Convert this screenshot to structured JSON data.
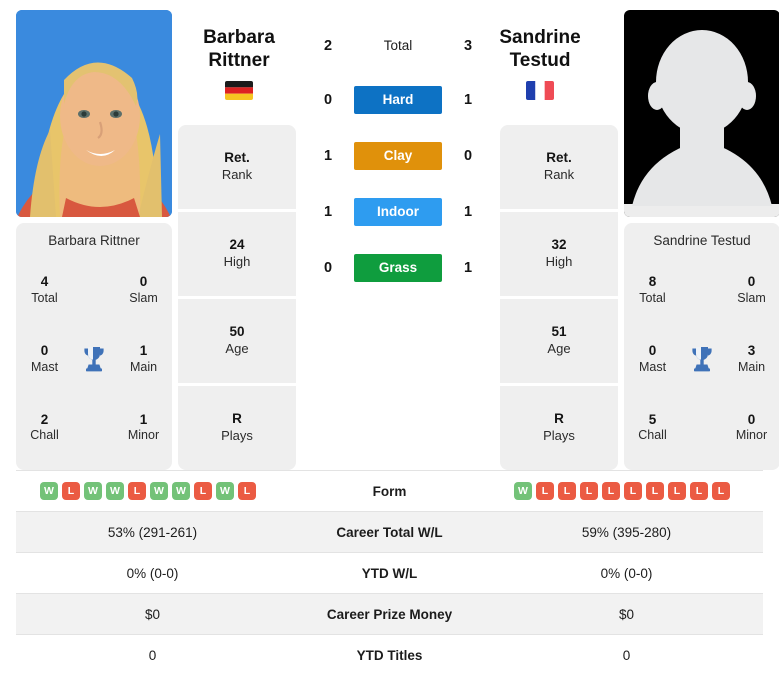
{
  "players": {
    "left": {
      "first_name": "Barbara",
      "last_name": "Rittner",
      "full_name": "Barbara Rittner",
      "country_flag": "germany-flag",
      "photo": "player-photo",
      "titles": {
        "total_value": "4",
        "total_label": "Total",
        "slam_value": "0",
        "slam_label": "Slam",
        "mast_value": "0",
        "mast_label": "Mast",
        "main_value": "1",
        "main_label": "Main",
        "chall_value": "2",
        "chall_label": "Chall",
        "minor_value": "1",
        "minor_label": "Minor"
      },
      "ranks": [
        {
          "value": "Ret.",
          "label": "Rank"
        },
        {
          "value": "24",
          "label": "High"
        },
        {
          "value": "50",
          "label": "Age"
        },
        {
          "value": "R",
          "label": "Plays"
        }
      ],
      "form": [
        "W",
        "L",
        "W",
        "W",
        "L",
        "W",
        "W",
        "L",
        "W",
        "L"
      ],
      "career_total_wl": "53% (291-261)",
      "ytd_wl": "0% (0-0)",
      "career_prize_money": "$0",
      "ytd_titles": "0"
    },
    "right": {
      "first_name": "Sandrine",
      "last_name": "Testud",
      "full_name": "Sandrine Testud",
      "country_flag": "france-flag",
      "photo": "player-photo-placeholder",
      "titles": {
        "total_value": "8",
        "total_label": "Total",
        "slam_value": "0",
        "slam_label": "Slam",
        "mast_value": "0",
        "mast_label": "Mast",
        "main_value": "3",
        "main_label": "Main",
        "chall_value": "5",
        "chall_label": "Chall",
        "minor_value": "0",
        "minor_label": "Minor"
      },
      "ranks": [
        {
          "value": "Ret.",
          "label": "Rank"
        },
        {
          "value": "32",
          "label": "High"
        },
        {
          "value": "51",
          "label": "Age"
        },
        {
          "value": "R",
          "label": "Plays"
        }
      ],
      "form": [
        "W",
        "L",
        "L",
        "L",
        "L",
        "L",
        "L",
        "L",
        "L",
        "L"
      ],
      "career_total_wl": "59% (395-280)",
      "ytd_wl": "0% (0-0)",
      "career_prize_money": "$0",
      "ytd_titles": "0"
    }
  },
  "h2h": {
    "total": {
      "label": "Total",
      "left": "2",
      "right": "3",
      "color": ""
    },
    "surfaces": [
      {
        "label": "Hard",
        "left": "0",
        "right": "1",
        "color": "#0d72c4"
      },
      {
        "label": "Clay",
        "left": "1",
        "right": "0",
        "color": "#e0910b"
      },
      {
        "label": "Indoor",
        "left": "1",
        "right": "1",
        "color": "#2e9cf0"
      },
      {
        "label": "Grass",
        "left": "0",
        "right": "1",
        "color": "#0f9d3e"
      }
    ]
  },
  "comparison_rows": [
    {
      "label": "Form",
      "type": "form"
    },
    {
      "label": "Career Total W/L",
      "left": "53% (291-261)",
      "right": "59% (395-280)"
    },
    {
      "label": "YTD W/L",
      "left": "0% (0-0)",
      "right": "0% (0-0)"
    },
    {
      "label": "Career Prize Money",
      "left": "$0",
      "right": "$0"
    },
    {
      "label": "YTD Titles",
      "left": "0",
      "right": "0"
    }
  ],
  "colors": {
    "card_bg": "#efefef",
    "row_shaded": "#f2f2f2",
    "win_badge": "#73c278",
    "loss_badge": "#eb5b43",
    "trophy": "#3f72b8"
  }
}
